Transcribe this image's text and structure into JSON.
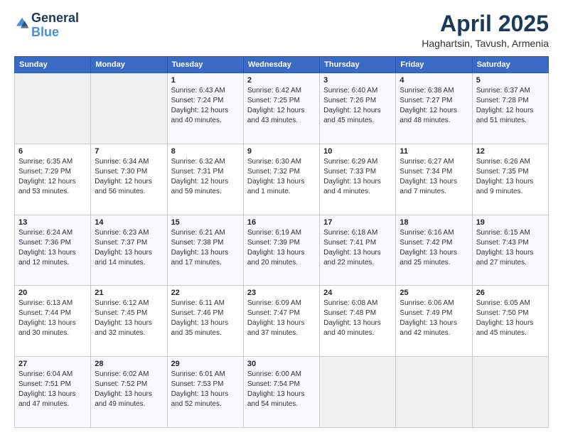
{
  "header": {
    "logo_line1": "General",
    "logo_line2": "Blue",
    "title": "April 2025",
    "location": "Haghartsin, Tavush, Armenia"
  },
  "weekdays": [
    "Sunday",
    "Monday",
    "Tuesday",
    "Wednesday",
    "Thursday",
    "Friday",
    "Saturday"
  ],
  "weeks": [
    [
      {
        "day": "",
        "sunrise": "",
        "sunset": "",
        "daylight": ""
      },
      {
        "day": "",
        "sunrise": "",
        "sunset": "",
        "daylight": ""
      },
      {
        "day": "1",
        "sunrise": "Sunrise: 6:43 AM",
        "sunset": "Sunset: 7:24 PM",
        "daylight": "Daylight: 12 hours and 40 minutes."
      },
      {
        "day": "2",
        "sunrise": "Sunrise: 6:42 AM",
        "sunset": "Sunset: 7:25 PM",
        "daylight": "Daylight: 12 hours and 43 minutes."
      },
      {
        "day": "3",
        "sunrise": "Sunrise: 6:40 AM",
        "sunset": "Sunset: 7:26 PM",
        "daylight": "Daylight: 12 hours and 45 minutes."
      },
      {
        "day": "4",
        "sunrise": "Sunrise: 6:38 AM",
        "sunset": "Sunset: 7:27 PM",
        "daylight": "Daylight: 12 hours and 48 minutes."
      },
      {
        "day": "5",
        "sunrise": "Sunrise: 6:37 AM",
        "sunset": "Sunset: 7:28 PM",
        "daylight": "Daylight: 12 hours and 51 minutes."
      }
    ],
    [
      {
        "day": "6",
        "sunrise": "Sunrise: 6:35 AM",
        "sunset": "Sunset: 7:29 PM",
        "daylight": "Daylight: 12 hours and 53 minutes."
      },
      {
        "day": "7",
        "sunrise": "Sunrise: 6:34 AM",
        "sunset": "Sunset: 7:30 PM",
        "daylight": "Daylight: 12 hours and 56 minutes."
      },
      {
        "day": "8",
        "sunrise": "Sunrise: 6:32 AM",
        "sunset": "Sunset: 7:31 PM",
        "daylight": "Daylight: 12 hours and 59 minutes."
      },
      {
        "day": "9",
        "sunrise": "Sunrise: 6:30 AM",
        "sunset": "Sunset: 7:32 PM",
        "daylight": "Daylight: 13 hours and 1 minute."
      },
      {
        "day": "10",
        "sunrise": "Sunrise: 6:29 AM",
        "sunset": "Sunset: 7:33 PM",
        "daylight": "Daylight: 13 hours and 4 minutes."
      },
      {
        "day": "11",
        "sunrise": "Sunrise: 6:27 AM",
        "sunset": "Sunset: 7:34 PM",
        "daylight": "Daylight: 13 hours and 7 minutes."
      },
      {
        "day": "12",
        "sunrise": "Sunrise: 6:26 AM",
        "sunset": "Sunset: 7:35 PM",
        "daylight": "Daylight: 13 hours and 9 minutes."
      }
    ],
    [
      {
        "day": "13",
        "sunrise": "Sunrise: 6:24 AM",
        "sunset": "Sunset: 7:36 PM",
        "daylight": "Daylight: 13 hours and 12 minutes."
      },
      {
        "day": "14",
        "sunrise": "Sunrise: 6:23 AM",
        "sunset": "Sunset: 7:37 PM",
        "daylight": "Daylight: 13 hours and 14 minutes."
      },
      {
        "day": "15",
        "sunrise": "Sunrise: 6:21 AM",
        "sunset": "Sunset: 7:38 PM",
        "daylight": "Daylight: 13 hours and 17 minutes."
      },
      {
        "day": "16",
        "sunrise": "Sunrise: 6:19 AM",
        "sunset": "Sunset: 7:39 PM",
        "daylight": "Daylight: 13 hours and 20 minutes."
      },
      {
        "day": "17",
        "sunrise": "Sunrise: 6:18 AM",
        "sunset": "Sunset: 7:41 PM",
        "daylight": "Daylight: 13 hours and 22 minutes."
      },
      {
        "day": "18",
        "sunrise": "Sunrise: 6:16 AM",
        "sunset": "Sunset: 7:42 PM",
        "daylight": "Daylight: 13 hours and 25 minutes."
      },
      {
        "day": "19",
        "sunrise": "Sunrise: 6:15 AM",
        "sunset": "Sunset: 7:43 PM",
        "daylight": "Daylight: 13 hours and 27 minutes."
      }
    ],
    [
      {
        "day": "20",
        "sunrise": "Sunrise: 6:13 AM",
        "sunset": "Sunset: 7:44 PM",
        "daylight": "Daylight: 13 hours and 30 minutes."
      },
      {
        "day": "21",
        "sunrise": "Sunrise: 6:12 AM",
        "sunset": "Sunset: 7:45 PM",
        "daylight": "Daylight: 13 hours and 32 minutes."
      },
      {
        "day": "22",
        "sunrise": "Sunrise: 6:11 AM",
        "sunset": "Sunset: 7:46 PM",
        "daylight": "Daylight: 13 hours and 35 minutes."
      },
      {
        "day": "23",
        "sunrise": "Sunrise: 6:09 AM",
        "sunset": "Sunset: 7:47 PM",
        "daylight": "Daylight: 13 hours and 37 minutes."
      },
      {
        "day": "24",
        "sunrise": "Sunrise: 6:08 AM",
        "sunset": "Sunset: 7:48 PM",
        "daylight": "Daylight: 13 hours and 40 minutes."
      },
      {
        "day": "25",
        "sunrise": "Sunrise: 6:06 AM",
        "sunset": "Sunset: 7:49 PM",
        "daylight": "Daylight: 13 hours and 42 minutes."
      },
      {
        "day": "26",
        "sunrise": "Sunrise: 6:05 AM",
        "sunset": "Sunset: 7:50 PM",
        "daylight": "Daylight: 13 hours and 45 minutes."
      }
    ],
    [
      {
        "day": "27",
        "sunrise": "Sunrise: 6:04 AM",
        "sunset": "Sunset: 7:51 PM",
        "daylight": "Daylight: 13 hours and 47 minutes."
      },
      {
        "day": "28",
        "sunrise": "Sunrise: 6:02 AM",
        "sunset": "Sunset: 7:52 PM",
        "daylight": "Daylight: 13 hours and 49 minutes."
      },
      {
        "day": "29",
        "sunrise": "Sunrise: 6:01 AM",
        "sunset": "Sunset: 7:53 PM",
        "daylight": "Daylight: 13 hours and 52 minutes."
      },
      {
        "day": "30",
        "sunrise": "Sunrise: 6:00 AM",
        "sunset": "Sunset: 7:54 PM",
        "daylight": "Daylight: 13 hours and 54 minutes."
      },
      {
        "day": "",
        "sunrise": "",
        "sunset": "",
        "daylight": ""
      },
      {
        "day": "",
        "sunrise": "",
        "sunset": "",
        "daylight": ""
      },
      {
        "day": "",
        "sunrise": "",
        "sunset": "",
        "daylight": ""
      }
    ]
  ]
}
